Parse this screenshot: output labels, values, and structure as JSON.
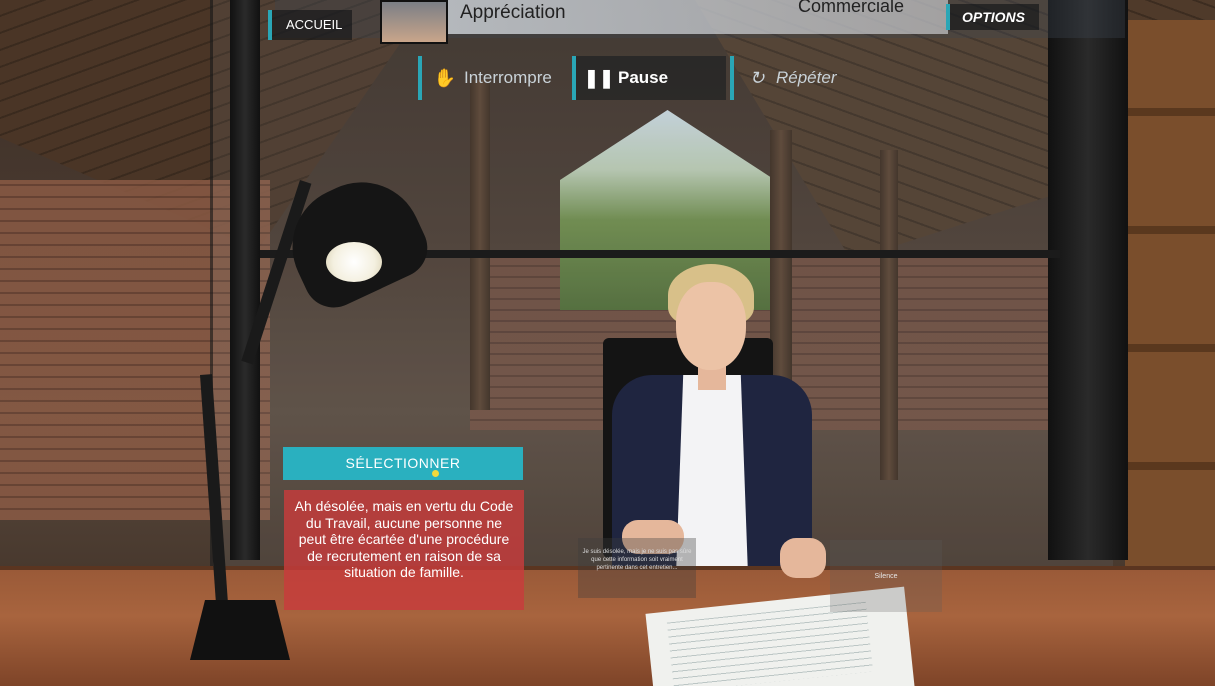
{
  "header": {
    "home_label": "ACCUEIL",
    "scenario_title": "Appréciation",
    "scenario_right": "Commerciale",
    "options_label": "OPTIONS"
  },
  "controls": {
    "interrupt_label": "Interrompre",
    "pause_label": "Pause",
    "repeat_label": "Répéter"
  },
  "dialog": {
    "select_label": "SÉLECTIONNER",
    "answer_text": "Ah désolée, mais en vertu du Code du Travail, aucune personne ne peut être écartée d'une procédure de recrutement en raison de sa situation de famille.",
    "option_faint": "Je suis désolée, mais je ne suis pas sûre que cette information soit vraiment pertinente dans cet entretien...",
    "option_silence": "Silence"
  },
  "colors": {
    "accent": "#2ab0bf",
    "answer_bg": "#c83c3c",
    "cursor": "#f2d93c"
  },
  "icons": {
    "interrupt": "hand-icon",
    "pause": "pause-icon",
    "repeat": "repeat-icon"
  }
}
